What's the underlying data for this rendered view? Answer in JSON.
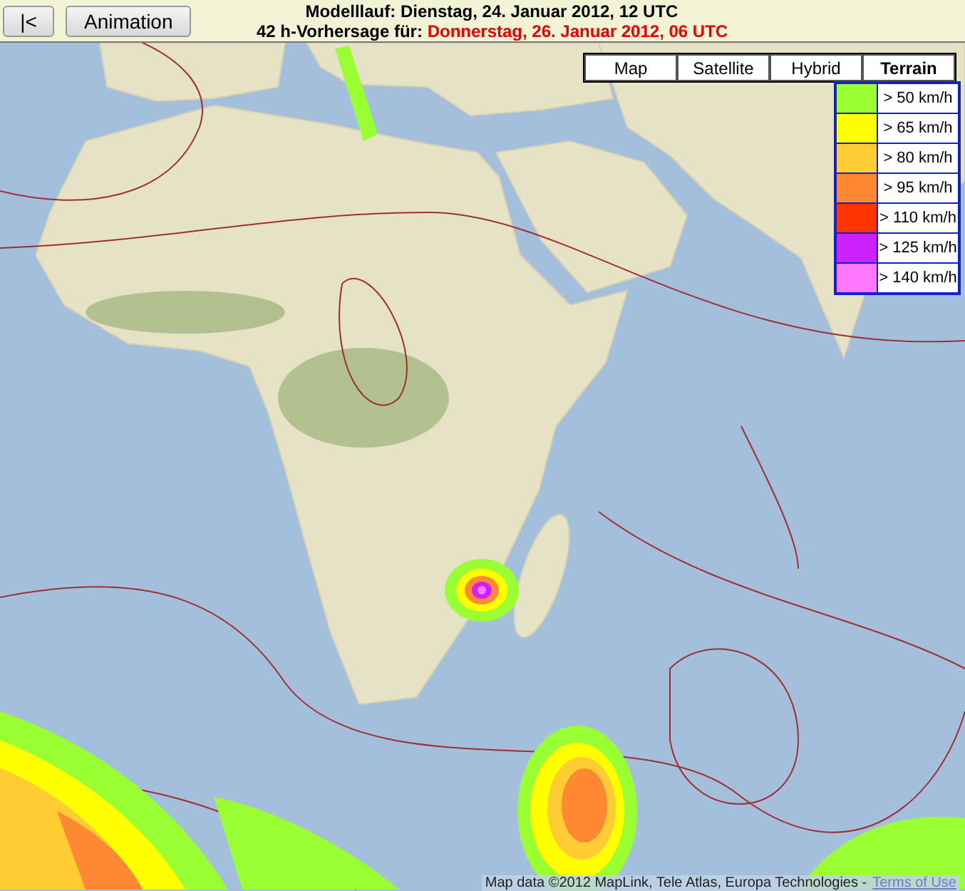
{
  "toolbar": {
    "buttons": [
      {
        "label": "|<"
      },
      {
        "label": "Animation"
      }
    ]
  },
  "header": {
    "model_run": "Modelllauf: Dienstag, 24. Januar 2012, 12 UTC",
    "forecast_label": "42 h-Vorhersage für:",
    "forecast_time": "Donnerstag, 26. Januar 2012, 06 UTC"
  },
  "map": {
    "map_types": [
      {
        "label": "Map",
        "selected": false
      },
      {
        "label": "Satellite",
        "selected": false
      },
      {
        "label": "Hybrid",
        "selected": false
      },
      {
        "label": "Terrain",
        "selected": true
      }
    ],
    "legend": [
      {
        "label": "> 50 km/h",
        "color": "#99ff33"
      },
      {
        "label": "> 65 km/h",
        "color": "#ffff00"
      },
      {
        "label": "> 80 km/h",
        "color": "#ffcc33"
      },
      {
        "label": "> 95 km/h",
        "color": "#ff8833"
      },
      {
        "label": "> 110 km/h",
        "color": "#ff3300"
      },
      {
        "label": "> 125 km/h",
        "color": "#cc22ff"
      },
      {
        "label": "> 140 km/h",
        "color": "#ff77ff"
      }
    ],
    "attribution": "Map data ©2012 MapLink, Tele Atlas, Europa Technologies -",
    "terms_link": "Terms of Use"
  }
}
